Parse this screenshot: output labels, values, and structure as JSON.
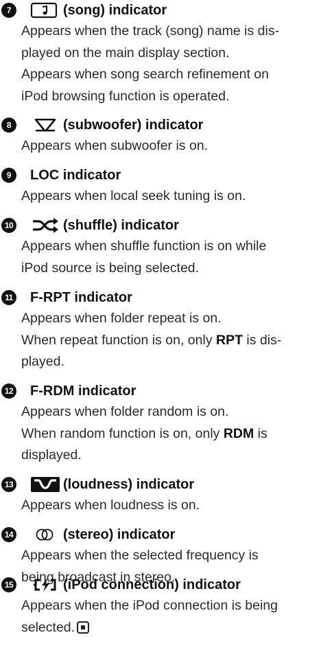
{
  "entries": [
    {
      "number": "7",
      "icon": "song-note-icon",
      "label": "(song) indicator",
      "lines": [
        "Appears when the track (song) name is dis-",
        "played on the main display section.",
        "Appears when song search refinement on",
        "iPod browsing function is operated."
      ]
    },
    {
      "number": "8",
      "icon": "subwoofer-icon",
      "label": "(subwoofer) indicator",
      "lines": [
        "Appears when subwoofer is on."
      ]
    },
    {
      "number": "9",
      "icon": "",
      "label": "LOC indicator",
      "lines": [
        "Appears when local seek tuning is on."
      ]
    },
    {
      "number": "10",
      "icon": "shuffle-icon",
      "label": "(shuffle) indicator",
      "lines": [
        "Appears when shuffle function is on while",
        "iPod source is being selected."
      ]
    },
    {
      "number": "11",
      "icon": "",
      "label": "F-RPT indicator",
      "lines": [
        "Appears when folder repeat is on.",
        "When repeat function is on, only |RPT| is dis-",
        "played."
      ]
    },
    {
      "number": "12",
      "icon": "",
      "label": "F-RDM indicator",
      "lines": [
        "Appears when folder random is on.",
        "When random function is on, only |RDM| is",
        "displayed."
      ]
    },
    {
      "number": "13",
      "icon": "loudness-icon",
      "label": "(loudness) indicator",
      "lines": [
        "Appears when loudness is on."
      ]
    },
    {
      "number": "14",
      "icon": "stereo-icon",
      "label": "(stereo) indicator",
      "lines": [
        "Appears when the selected frequency is",
        "being broadcast in stereo."
      ]
    },
    {
      "number": "15",
      "icon": "ipod-connection-icon",
      "label": "(iPod connection) indicator",
      "lines": [
        "Appears when the iPod connection is being",
        "selected."
      ],
      "end_mark": "end-of-section-icon"
    }
  ]
}
